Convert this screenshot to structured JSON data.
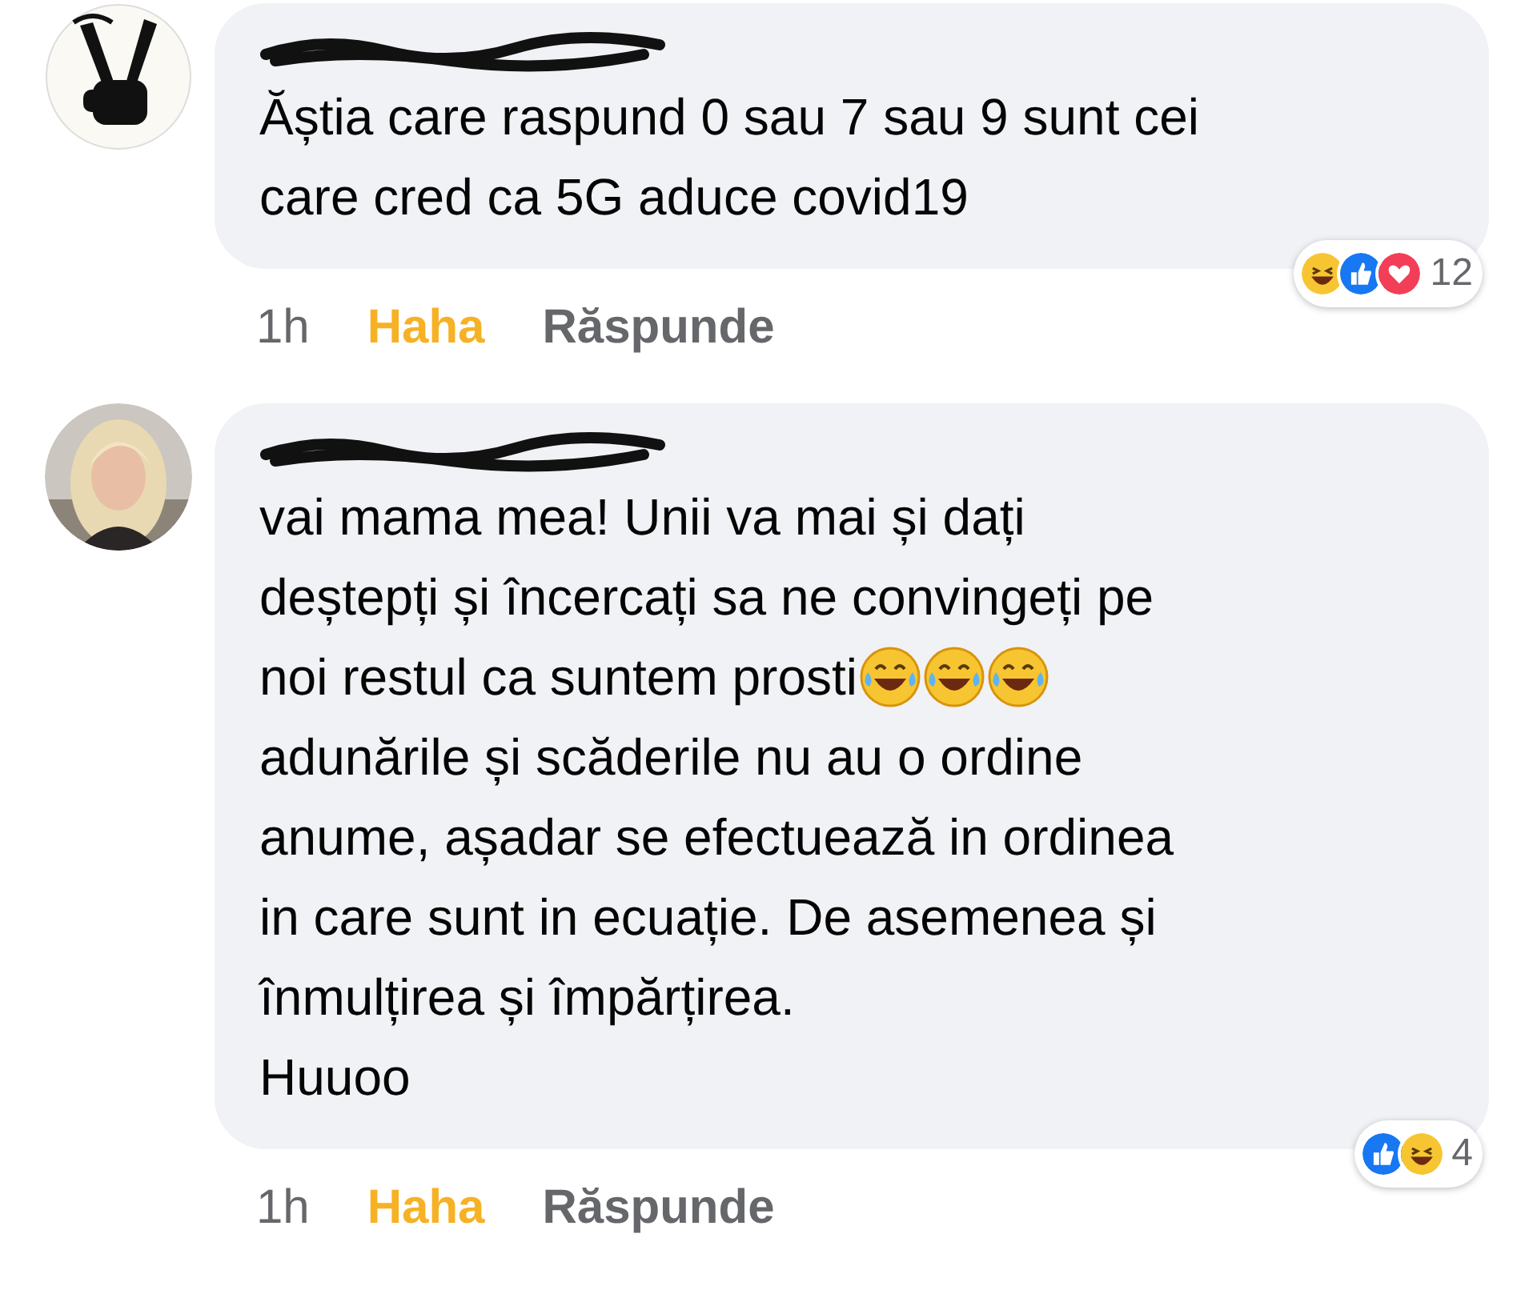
{
  "comments": [
    {
      "avatar": {
        "kind": "hand"
      },
      "body": [
        {
          "text": "Ăștia care raspund 0 sau 7 sau 9 sunt cei"
        },
        {
          "text": "care cred ca 5G aduce covid19"
        }
      ],
      "time": "1h",
      "reaction_link": {
        "label": "Haha",
        "selected": true
      },
      "reply": "Răspunde",
      "reactions": {
        "types": [
          {
            "kind": "haha"
          },
          {
            "kind": "like"
          },
          {
            "kind": "love"
          }
        ],
        "count": "12"
      }
    },
    {
      "body": [
        {
          "text": "vai mama mea! Unii va mai și dați"
        },
        {
          "text": "deștepți și încercați sa ne convingeți pe"
        },
        {
          "text": "noi restul ca suntem prosti",
          "emojis": [
            {
              "kind": "laugh-tears"
            },
            {
              "kind": "laugh-tears"
            },
            {
              "kind": "laugh-tears"
            }
          ]
        },
        {
          "text": "adunările și scăderile nu au o ordine"
        },
        {
          "text": "anume, așadar se efectuează in ordinea"
        },
        {
          "text": "in care sunt in ecuație. De asemenea și"
        },
        {
          "text": "înmulțirea și împărțirea."
        },
        {
          "text": "Huuoo"
        }
      ],
      "time": "1h",
      "reaction_link": {
        "label": "Haha",
        "selected": true
      },
      "reply": "Răspunde",
      "reactions": {
        "types": [
          {
            "kind": "like"
          },
          {
            "kind": "haha"
          }
        ],
        "count": "4"
      }
    }
  ]
}
